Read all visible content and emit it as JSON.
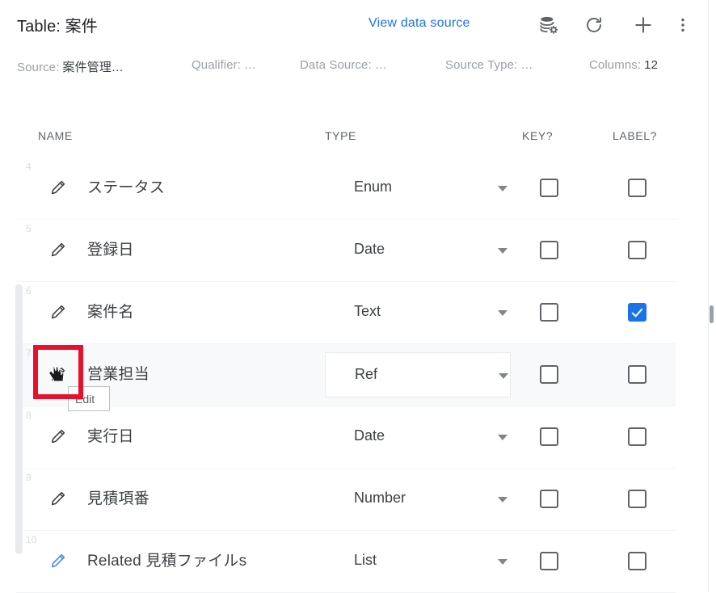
{
  "header": {
    "title_label": "Table:",
    "title_value": "案件",
    "view_data_source": "View data source",
    "icons": {
      "database_settings": "database-settings-icon",
      "refresh": "refresh-icon",
      "add": "plus-icon",
      "more": "more-vertical-icon"
    }
  },
  "meta": {
    "source_label": "Source:",
    "source_value": "案件管理…",
    "qualifier_label": "Qualifier:",
    "qualifier_value": "…",
    "data_source_label": "Data Source:",
    "data_source_value": "…",
    "source_type_label": "Source Type:",
    "source_type_value": "…",
    "columns_label": "Columns:",
    "columns_value": "12"
  },
  "columns": {
    "name": "NAME",
    "type": "TYPE",
    "key": "KEY?",
    "label": "LABEL?"
  },
  "rows": [
    {
      "num": "4",
      "name": "ステータス",
      "type": "Enum",
      "key": false,
      "label": false,
      "pencil_color": "#3c4043",
      "highlighted": false
    },
    {
      "num": "5",
      "name": "登録日",
      "type": "Date",
      "key": false,
      "label": false,
      "pencil_color": "#3c4043",
      "highlighted": false
    },
    {
      "num": "6",
      "name": "案件名",
      "type": "Text",
      "key": false,
      "label": true,
      "pencil_color": "#3c4043",
      "highlighted": false
    },
    {
      "num": "7",
      "name": "営業担当",
      "type": "Ref",
      "key": false,
      "label": false,
      "pencil_color": "#3c4043",
      "highlighted": true
    },
    {
      "num": "8",
      "name": "実行日",
      "type": "Date",
      "key": false,
      "label": false,
      "pencil_color": "#3c4043",
      "highlighted": false
    },
    {
      "num": "9",
      "name": "見積項番",
      "type": "Number",
      "key": false,
      "label": false,
      "pencil_color": "#3c4043",
      "highlighted": false
    },
    {
      "num": "10",
      "name": "Related 見積ファイルs",
      "type": "List",
      "key": false,
      "label": false,
      "pencil_color": "#4285f4",
      "highlighted": false
    }
  ],
  "tooltip": {
    "text": "Edit"
  },
  "annotation": {
    "color": "#e8112d"
  },
  "theme": {
    "link_blue": "#1a73e8",
    "checkbox_blue": "#1a73e8",
    "row_highlight": "#f8f9fb"
  }
}
